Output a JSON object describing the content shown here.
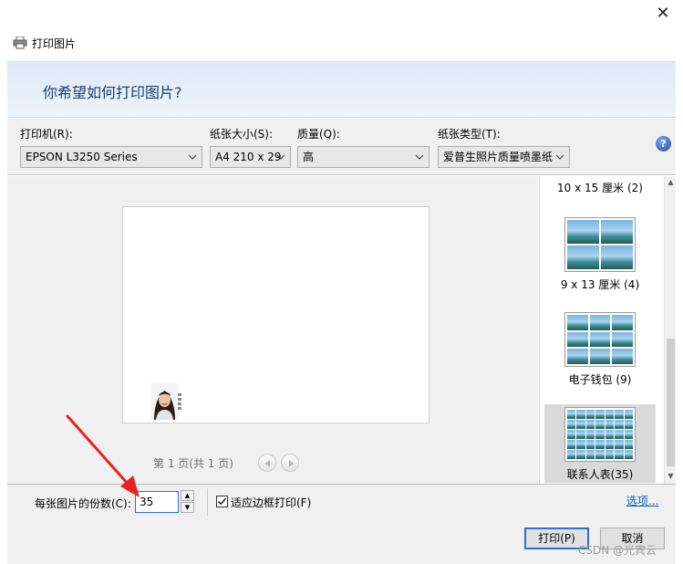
{
  "window": {
    "title": "打印图片",
    "close": "✕"
  },
  "banner": {
    "question": "你希望如何打印图片?"
  },
  "options": {
    "printer_label": "打印机(R):",
    "printer_value": "EPSON L3250 Series",
    "paper_size_label": "纸张大小(S):",
    "paper_size_value": "A4 210 x 29",
    "quality_label": "质量(Q):",
    "quality_value": "高",
    "paper_type_label": "纸张类型(T):",
    "paper_type_value": "爱普生照片质量喷墨纸",
    "help": "?"
  },
  "preview": {
    "page_label": "第 1 页(共 1 页)"
  },
  "layouts": {
    "items": [
      {
        "caption": "10 x 15 厘米 (2)"
      },
      {
        "caption": "9 x 13 厘米 (4)"
      },
      {
        "caption": "电子钱包 (9)"
      },
      {
        "caption": "联系人表(35)"
      }
    ],
    "selected_index": 3
  },
  "copies": {
    "label": "每张图片的份数(C):",
    "value": "35",
    "fit_label": "适应边框打印(F)",
    "fit_checked": true,
    "options_link": "选项..."
  },
  "buttons": {
    "print": "打印(P)",
    "cancel": "取消"
  },
  "watermark": "CSDN @光宾云",
  "colors": {
    "banner_text": "#1e3d74",
    "link": "#0b5fb3",
    "focus": "#2f6fd6",
    "arrow": "#e8231f"
  }
}
